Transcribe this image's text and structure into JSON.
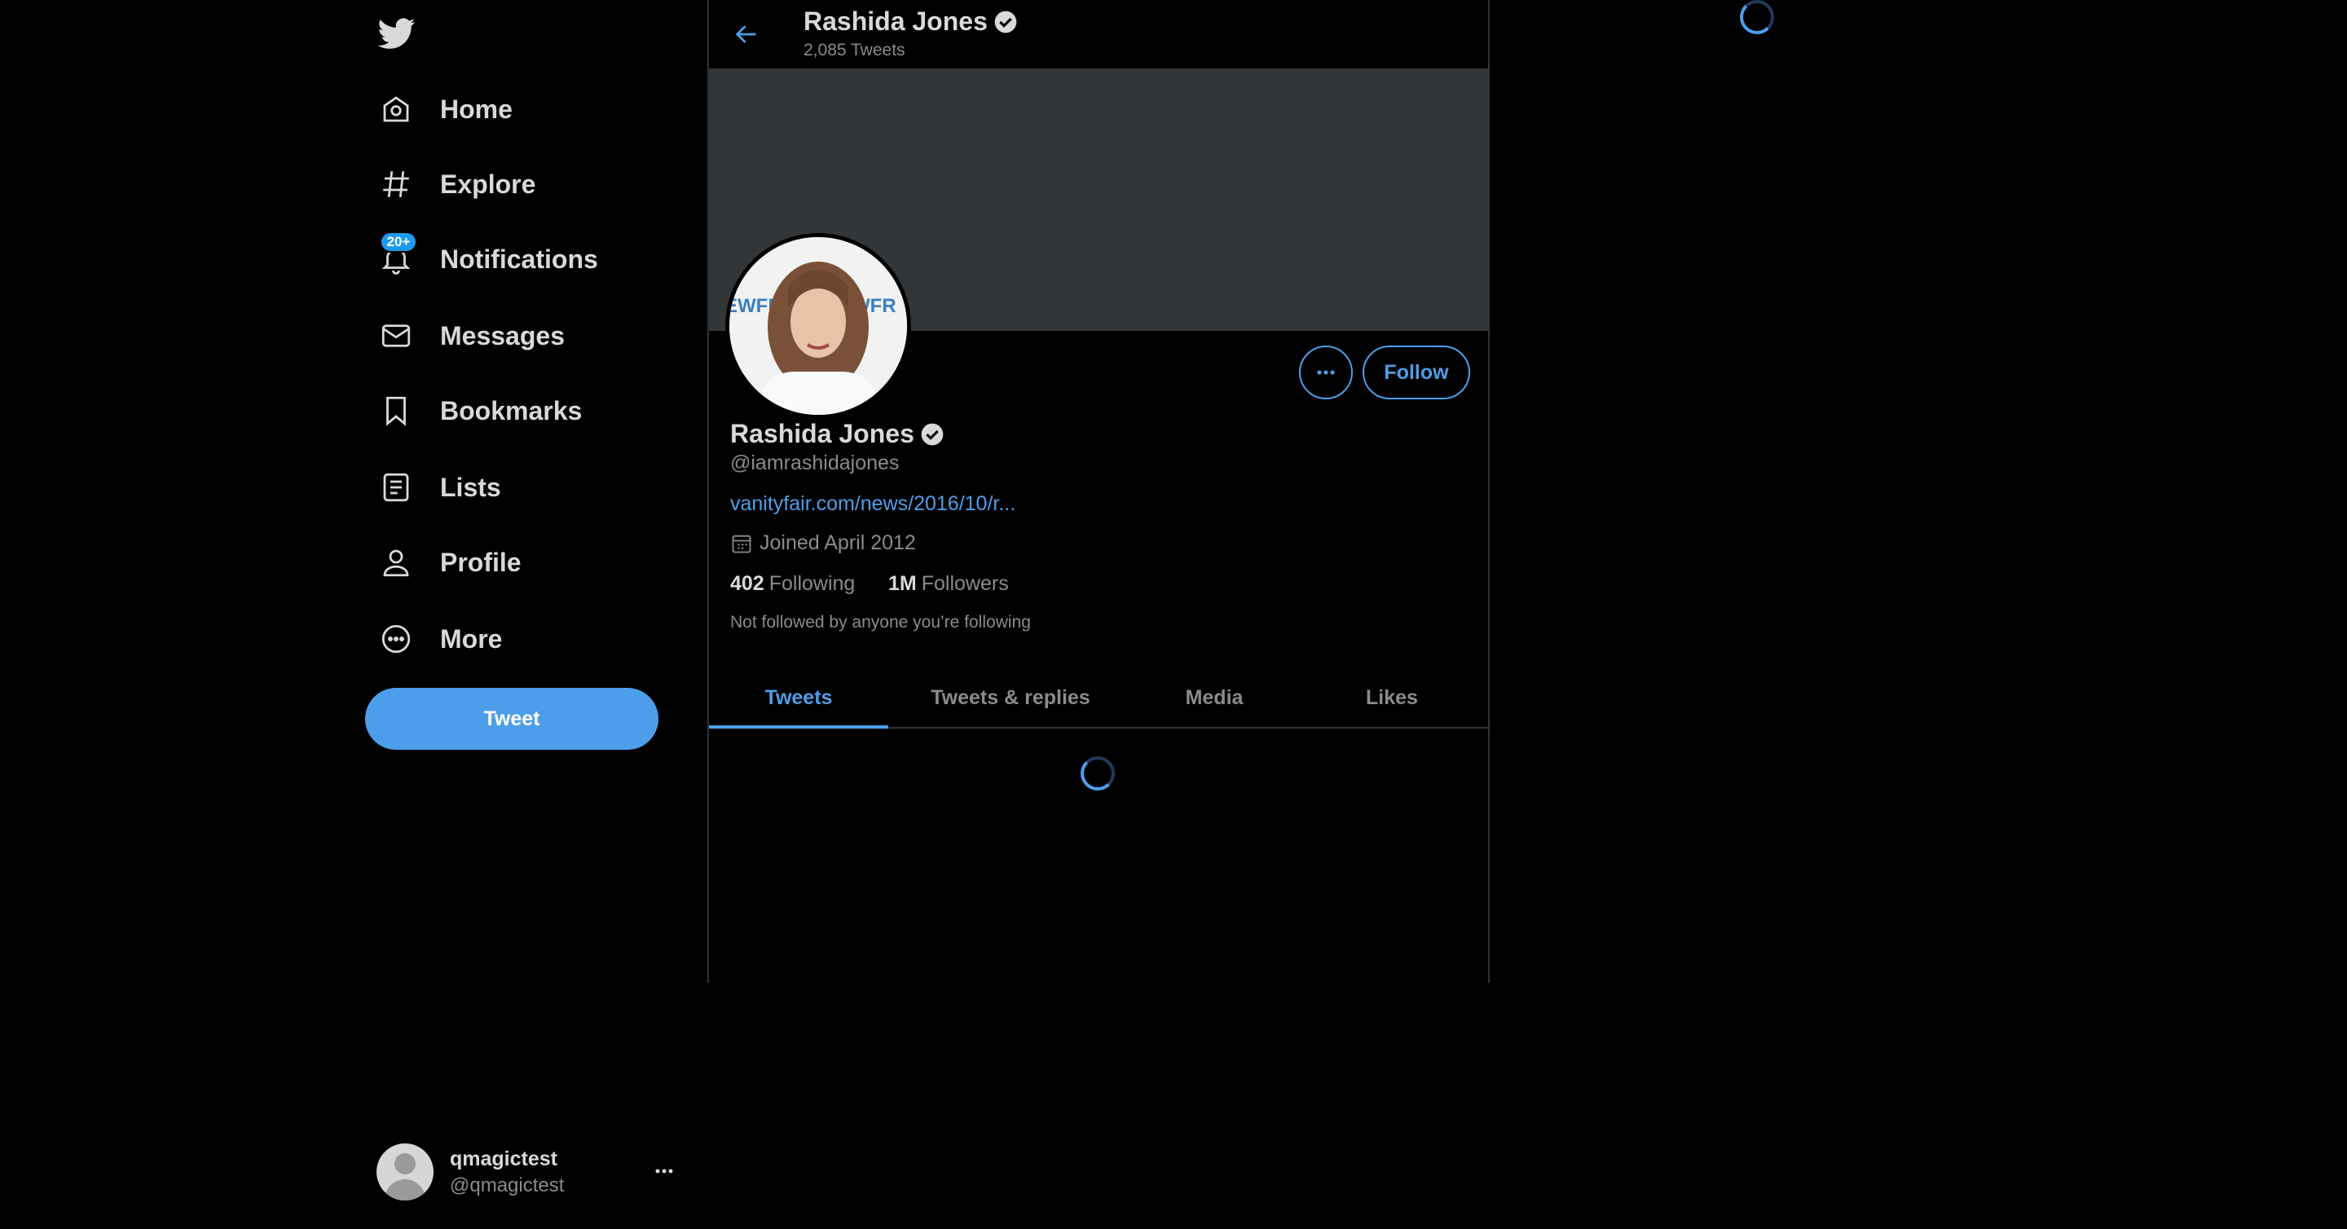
{
  "sidebar": {
    "logo": "twitter-bird-icon",
    "items": [
      {
        "label": "Home",
        "icon": "home-icon"
      },
      {
        "label": "Explore",
        "icon": "hashtag-icon"
      },
      {
        "label": "Notifications",
        "icon": "bell-icon",
        "badge": "20+"
      },
      {
        "label": "Messages",
        "icon": "envelope-icon"
      },
      {
        "label": "Bookmarks",
        "icon": "bookmark-icon"
      },
      {
        "label": "Lists",
        "icon": "list-icon"
      },
      {
        "label": "Profile",
        "icon": "person-icon"
      },
      {
        "label": "More",
        "icon": "more-circle-icon"
      }
    ],
    "tweet_button": "Tweet",
    "account": {
      "name": "qmagictest",
      "handle": "@qmagictest"
    }
  },
  "header": {
    "name": "Rashida Jones",
    "tweet_count": "2,085 Tweets"
  },
  "profile": {
    "name": "Rashida Jones",
    "handle": "@iamrashidajones",
    "link": "vanityfair.com/news/2016/10/r...",
    "joined": "Joined April 2012",
    "following_count": "402",
    "following_label": "Following",
    "followers_count": "1M",
    "followers_label": "Followers",
    "note": "Not followed by anyone you’re following",
    "follow_button": "Follow"
  },
  "tabs": [
    {
      "label": "Tweets",
      "active": true
    },
    {
      "label": "Tweets & replies",
      "active": false
    },
    {
      "label": "Media",
      "active": false
    },
    {
      "label": "Likes",
      "active": false
    }
  ],
  "colors": {
    "accent": "#4d9eea",
    "background": "#000000",
    "banner": "#333638",
    "text": "#d9d9d9",
    "muted": "#8b8b8b"
  }
}
